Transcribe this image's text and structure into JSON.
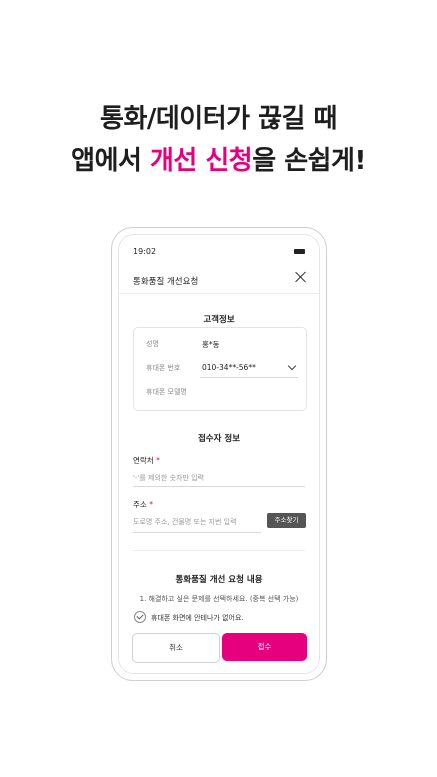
{
  "headline": {
    "line1": "통화/데이터가 끊길 때",
    "line2_prefix": "앱에서 ",
    "line2_accent": "개선 신청",
    "line2_suffix": "을 손쉽게!",
    "accent_color": "#e6007e"
  },
  "status_bar": {
    "time": "19:02"
  },
  "app_bar": {
    "title": "통화품질 개선요청",
    "close_icon": "close-icon"
  },
  "customer_info": {
    "title": "고객정보",
    "rows": [
      {
        "label": "성명",
        "value": "홍*동"
      },
      {
        "label": "휴대폰 번호",
        "value": "010-34**-56**"
      },
      {
        "label": "휴대폰 모델명",
        "value": ""
      }
    ]
  },
  "receiver_info": {
    "title": "접수자 정보",
    "contact_label": "연락처",
    "contact_placeholder": "'-'를 제외한 숫자만 입력",
    "address_label": "주소",
    "address_placeholder": "도로명 주소, 건물명 또는 지번 입력",
    "address_button": "주소찾기",
    "required_mark": "*"
  },
  "request_content": {
    "title": "통화품질 개선 요청 내용",
    "instruction": "1. 해결하고 싶은 문제를 선택하세요. (중복 선택 가능)",
    "options": [
      "휴대폰 화면에 안테나가 없어요."
    ]
  },
  "buttons": {
    "cancel": "취소",
    "submit": "접수"
  }
}
